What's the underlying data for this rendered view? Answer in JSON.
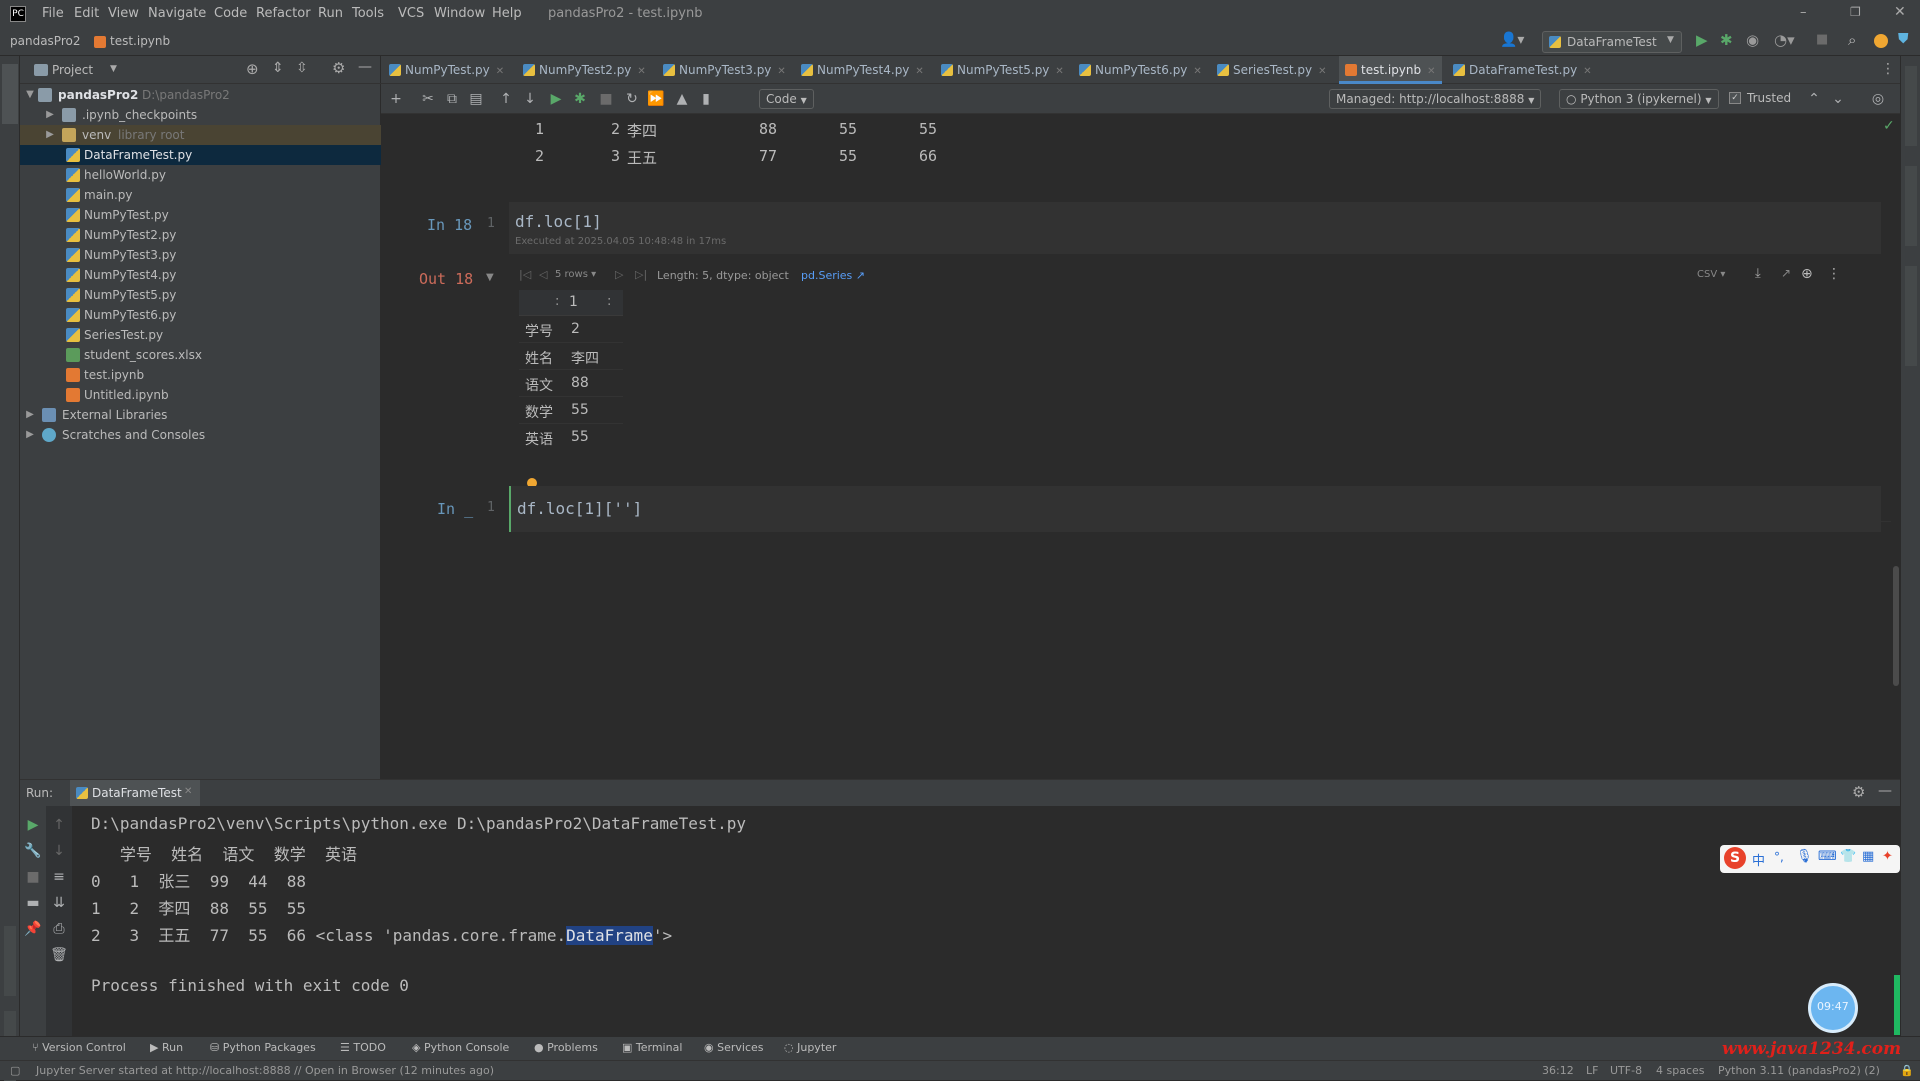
{
  "window": {
    "title": "pandasPro2 - test.ipynb"
  },
  "menu": [
    "File",
    "Edit",
    "View",
    "Navigate",
    "Code",
    "Refactor",
    "Run",
    "Tools",
    "VCS",
    "Window",
    "Help"
  ],
  "breadcrumb": {
    "project": "pandasPro2",
    "file": "test.ipynb"
  },
  "run_config": "DataFrameTest",
  "project_panel": {
    "title": "Project",
    "root": {
      "name": "pandasPro2",
      "path": "D:\\pandasPro2"
    },
    "items": [
      {
        "name": ".ipynb_checkpoints",
        "kind": "folder",
        "note": ""
      },
      {
        "name": "venv",
        "kind": "folder",
        "note": "library root"
      },
      {
        "name": "DataFrameTest.py",
        "kind": "py",
        "note": ""
      },
      {
        "name": "helloWorld.py",
        "kind": "py",
        "note": ""
      },
      {
        "name": "main.py",
        "kind": "py",
        "note": ""
      },
      {
        "name": "NumPyTest.py",
        "kind": "py",
        "note": ""
      },
      {
        "name": "NumPyTest2.py",
        "kind": "py",
        "note": ""
      },
      {
        "name": "NumPyTest3.py",
        "kind": "py",
        "note": ""
      },
      {
        "name": "NumPyTest4.py",
        "kind": "py",
        "note": ""
      },
      {
        "name": "NumPyTest5.py",
        "kind": "py",
        "note": ""
      },
      {
        "name": "NumPyTest6.py",
        "kind": "py",
        "note": ""
      },
      {
        "name": "SeriesTest.py",
        "kind": "py",
        "note": ""
      },
      {
        "name": "student_scores.xlsx",
        "kind": "xlsx",
        "note": ""
      },
      {
        "name": "test.ipynb",
        "kind": "ipynb",
        "note": ""
      },
      {
        "name": "Untitled.ipynb",
        "kind": "ipynb",
        "note": ""
      }
    ],
    "external": "External Libraries",
    "scratches": "Scratches and Consoles"
  },
  "editor_tabs": [
    "NumPyTest.py",
    "NumPyTest2.py",
    "NumPyTest3.py",
    "NumPyTest4.py",
    "NumPyTest5.py",
    "NumPyTest6.py",
    "SeriesTest.py",
    "test.ipynb",
    "DataFrameTest.py"
  ],
  "notebook_toolbar": {
    "cell_type": "Code",
    "server": "Managed: http://localhost:8888",
    "kernel": "Python 3 (ipykernel)",
    "trusted": "Trusted"
  },
  "prev_output_rows": [
    {
      "idx": "1",
      "id": "2",
      "name": "李四",
      "a": "88",
      "b": "55",
      "c": "55"
    },
    {
      "idx": "2",
      "id": "3",
      "name": "王五",
      "a": "77",
      "b": "55",
      "c": "66"
    }
  ],
  "cell_in18": {
    "label": "In 18",
    "line": "1",
    "code": "df.loc[1]",
    "executed": "Executed at 2025.04.05 10:48:48 in 17ms"
  },
  "cell_out18": {
    "label": "Out 18",
    "pager": "5 rows",
    "meta": "Length: 5, dtype: object",
    "type_link": "pd.Series ↗",
    "format": "CSV",
    "column_header": "1",
    "rows": [
      {
        "key": "学号",
        "val": "2"
      },
      {
        "key": "姓名",
        "val": "李四"
      },
      {
        "key": "语文",
        "val": "88"
      },
      {
        "key": "数学",
        "val": "55"
      },
      {
        "key": "英语",
        "val": "55"
      }
    ]
  },
  "cell_in_new": {
    "label": "In _",
    "line": "1",
    "code": "df.loc[1]['']"
  },
  "run_panel": {
    "label": "Run:",
    "tab": "DataFrameTest",
    "lines": [
      "D:\\pandasPro2\\venv\\Scripts\\python.exe D:\\pandasPro2\\DataFrameTest.py",
      "   学号  姓名  语文  数学  英语",
      "0   1  张三  99  44  88",
      "1   2  李四  88  55  55"
    ],
    "last_row_prefix": "2   3  王五  77  55  66 <class 'pandas.core.frame.",
    "last_row_highlight": "DataFrame",
    "last_row_suffix": "'>",
    "exit": "Process finished with exit code 0"
  },
  "bottom_tabs": [
    "Version Control",
    "Run",
    "Python Packages",
    "TODO",
    "Python Console",
    "Problems",
    "Terminal",
    "Services",
    "Jupyter"
  ],
  "status": {
    "message": "Jupyter Server started at http://localhost:8888 // Open in Browser (12 minutes ago)",
    "position": "36:12",
    "line_sep": "LF",
    "encoding": "UTF-8",
    "indent": "4 spaces",
    "interpreter": "Python 3.11 (pandasPro2) (2)"
  },
  "clock": "09:47",
  "watermark": "www.java1234.com",
  "ime": "中"
}
